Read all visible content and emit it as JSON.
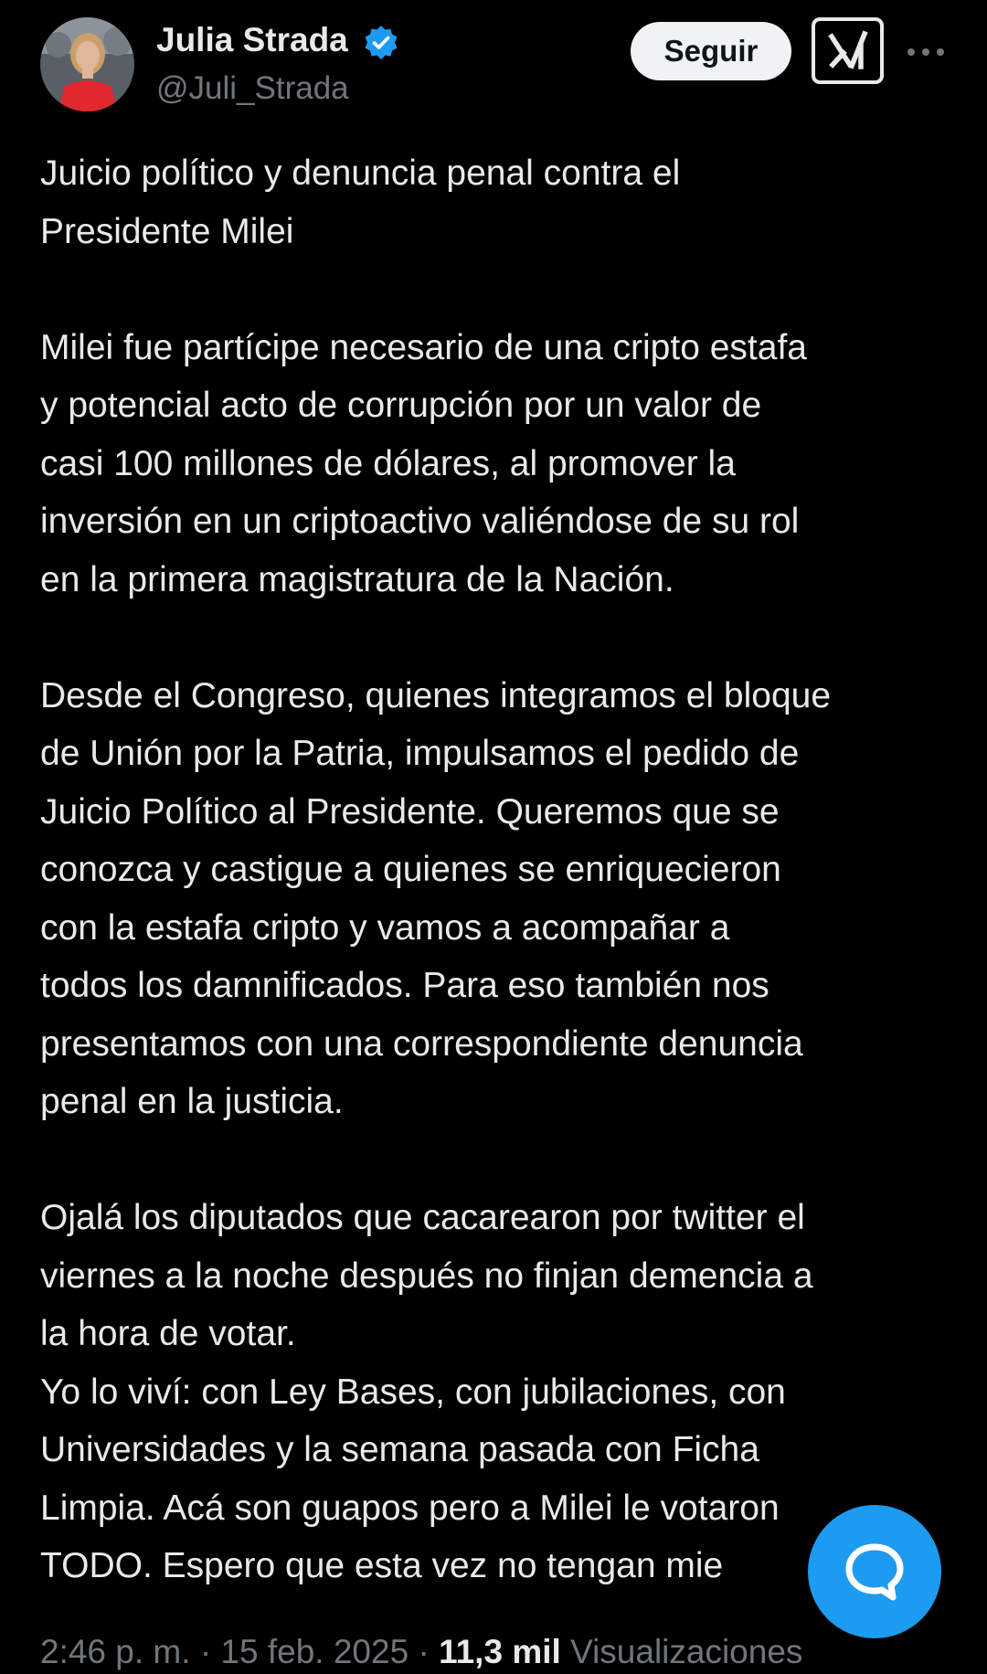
{
  "author": {
    "display_name": "Julia Strada",
    "handle": "@Juli_Strada",
    "verified": true,
    "avatar_icon": "profile-photo"
  },
  "actions": {
    "follow_label": "Seguir",
    "grok_icon": "grok-icon",
    "more_icon": "more-options-icon"
  },
  "post": {
    "paragraphs": [
      "Juicio político y denuncia penal contra el\nPresidente Milei",
      "Milei fue partícipe necesario de una cripto estafa\ny potencial acto de corrupción por un valor de\ncasi 100 millones de dólares, al promover la\ninversión en un criptoactivo valiéndose de su rol\nen la primera magistratura de la Nación.",
      "Desde el Congreso, quienes integramos el bloque\nde Unión por la Patria, impulsamos el pedido de\nJuicio Político al Presidente. Queremos que se\nconozca y castigue a quienes se enriquecieron\ncon la estafa cripto y vamos a acompañar a\ntodos los damnificados. Para eso también nos\npresentamos con una correspondiente denuncia\npenal en la justicia.",
      "Ojalá los diputados que cacarearon por twitter el\nviernes a la noche después no finjan demencia a\nla hora de votar.\nYo lo viví: con Ley Bases, con jubilaciones, con\nUniversidades y la semana pasada con Ficha\nLimpia. Acá son guapos pero a Milei le votaron\nTODO. Espero que esta vez no tengan mie"
    ]
  },
  "meta": {
    "time": "2:46 p. m.",
    "separator": "·",
    "date": "15 feb. 2025",
    "views_count": "11,3 mil",
    "views_label": "Visualizaciones"
  },
  "fab": {
    "icon": "compose-message-icon"
  },
  "colors": {
    "background": "#000000",
    "text": "#e7e9ea",
    "secondary_text": "#71767b",
    "accent": "#1d9bf0",
    "follow_button_bg": "#eff3f4"
  }
}
